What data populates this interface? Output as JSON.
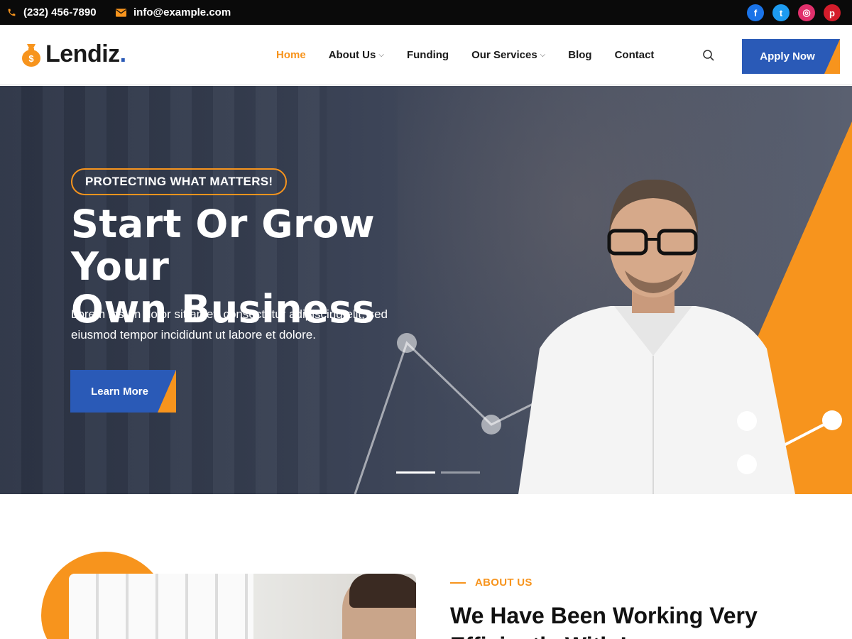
{
  "topbar": {
    "phone": "(232) 456-7890",
    "email": "info@example.com",
    "social": [
      {
        "icon": "facebook-icon",
        "glyph": "f",
        "color": "#1a73e8"
      },
      {
        "icon": "twitter-icon",
        "glyph": "t",
        "color": "#1d9bf0"
      },
      {
        "icon": "instagram-icon",
        "glyph": "◎",
        "color": "#e1306c"
      },
      {
        "icon": "pinterest-icon",
        "glyph": "p",
        "color": "#d41c2b"
      }
    ]
  },
  "navbar": {
    "logo_text": "Lendiz",
    "logo_dot": ".",
    "menu": [
      {
        "label": "Home",
        "active": true,
        "dropdown": false
      },
      {
        "label": "About Us",
        "active": false,
        "dropdown": true
      },
      {
        "label": "Funding",
        "active": false,
        "dropdown": false
      },
      {
        "label": "Our Services",
        "active": false,
        "dropdown": true
      },
      {
        "label": "Blog",
        "active": false,
        "dropdown": false
      },
      {
        "label": "Contact",
        "active": false,
        "dropdown": false
      }
    ],
    "apply_label": "Apply Now"
  },
  "hero": {
    "tagline": "PROTECTING WHAT MATTERS!",
    "title_line1": "Start Or Grow Your",
    "title_line2": "Own Business",
    "text_line1": "Lorem ipsum dolor sit amet, consectetur adipiscing elit, sed",
    "text_line2": "eiusmod tempor incididunt ut labore et dolore.",
    "cta_label": "Learn More",
    "slides": 2,
    "active_slide": 1
  },
  "about": {
    "label": "ABOUT US",
    "title": "We Have Been Working Very Efficiently With Loan"
  },
  "colors": {
    "accent": "#f7941d",
    "primary": "#2a5ab7",
    "dark": "#0a0a0a"
  }
}
